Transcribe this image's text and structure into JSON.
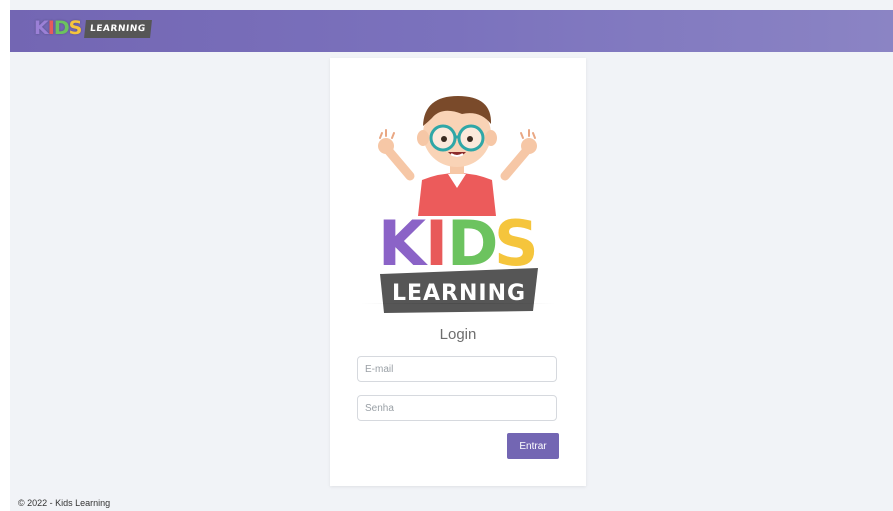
{
  "header": {
    "logo": {
      "letters": [
        "K",
        "I",
        "D",
        "S"
      ],
      "tag": "LEARNING"
    }
  },
  "card": {
    "illustration_logo": {
      "letters": [
        "K",
        "I",
        "D",
        "S"
      ],
      "tag": "LEARNING"
    },
    "title": "Login",
    "email": {
      "placeholder": "E-mail",
      "value": ""
    },
    "password": {
      "placeholder": "Senha",
      "value": ""
    },
    "submit_label": "Entrar"
  },
  "footer": {
    "text": "© 2022 - Kids Learning"
  },
  "colors": {
    "primary": "#7366b3",
    "background": "#f1f3f7",
    "letter_k": "#9b80d6",
    "letter_i": "#e85a5a",
    "letter_d": "#6cc35f",
    "letter_s": "#f5c53c",
    "tag_bg": "#565656"
  }
}
